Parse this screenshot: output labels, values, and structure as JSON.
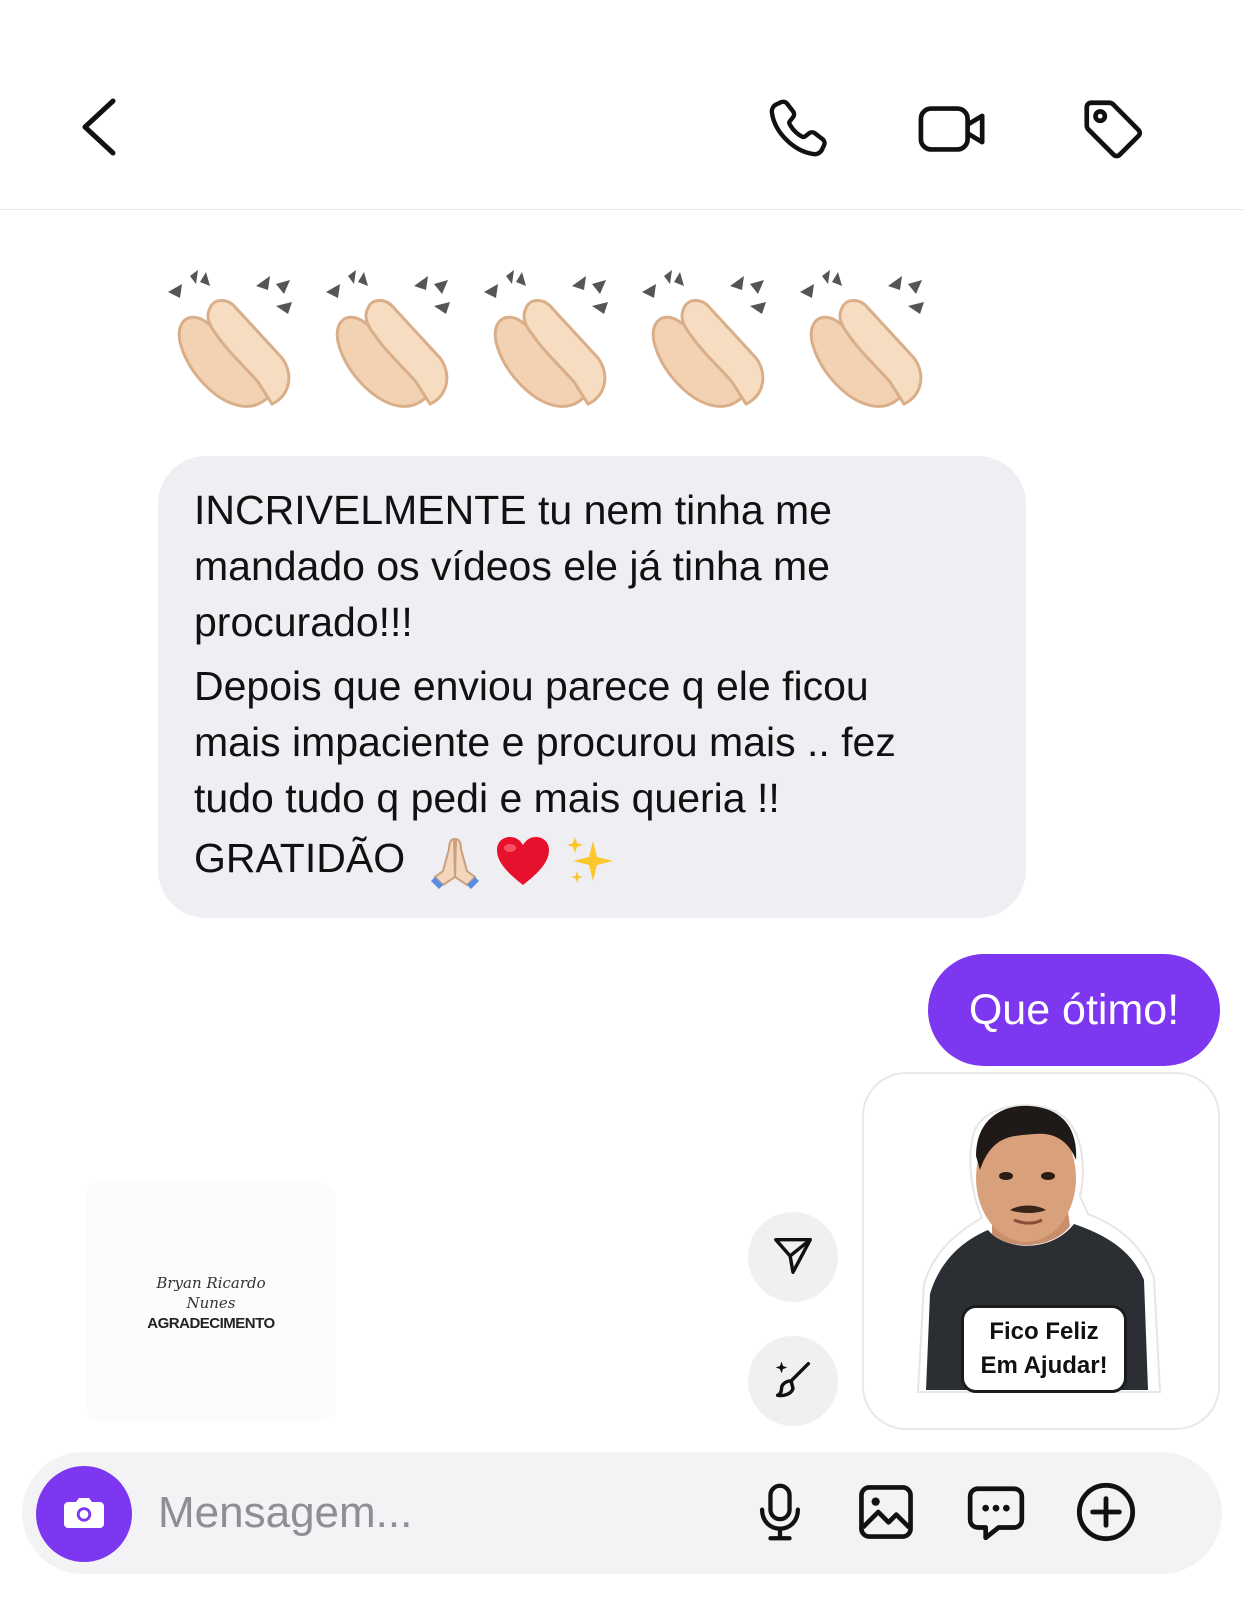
{
  "header": {
    "back_icon": "chevron-left-icon",
    "actions": [
      "phone-icon",
      "video-camera-icon",
      "tag-icon"
    ]
  },
  "messages": {
    "claps": [
      "👏🏻",
      "👏🏻",
      "👏🏻",
      "👏🏻",
      "👏🏻"
    ],
    "incoming": {
      "lines": [
        "INCRIVELMENTE tu nem tinha me",
        "mandado os vídeos ele já tinha me",
        "procurado!!!",
        "Depois que enviou parece q ele ficou",
        "mais impaciente e procurou mais .. fez",
        "tudo tudo q pedi e mais queria !!",
        "GRATIDÃO"
      ],
      "emojis": [
        "🙏🏻",
        "❤️",
        "✨"
      ]
    },
    "outgoing": {
      "text": "Que ótimo!"
    },
    "sticker": {
      "caption_line1": "Fico Feliz",
      "caption_line2": "Em Ajudar!"
    }
  },
  "watermark": {
    "name_line1": "Bryan Ricardo",
    "name_line2": "Nunes",
    "title": "AGRADECIMENTO"
  },
  "side_actions": [
    "send-icon",
    "brush-sparkle-icon"
  ],
  "composer": {
    "placeholder": "Mensagem...",
    "value": "",
    "icons": [
      "camera-icon",
      "microphone-icon",
      "gallery-icon",
      "chat-bubble-icon",
      "plus-circle-icon"
    ]
  },
  "colors": {
    "accent": "#7d37f0",
    "incoming_bubble": "#efeff3",
    "composer_bg": "#f3f3f6"
  }
}
